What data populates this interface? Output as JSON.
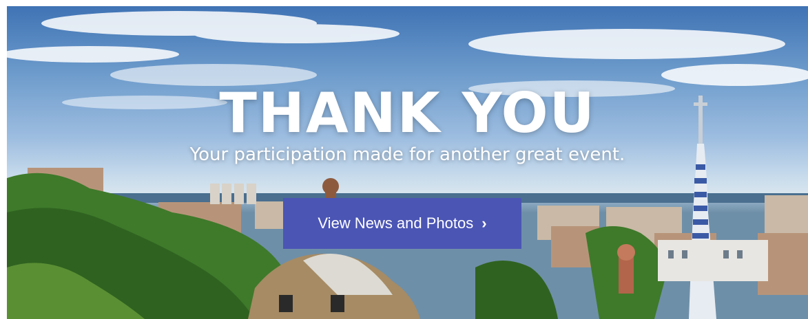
{
  "hero": {
    "title": "THANK YOU",
    "subtitle": "Your participation made for another great event.",
    "image_description_icon": "city-landscape-photo"
  },
  "cta": {
    "label": "View News and Photos",
    "chevron": "›",
    "color": "#4b55b4"
  }
}
